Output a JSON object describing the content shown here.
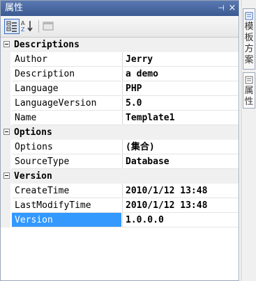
{
  "panel": {
    "title": "属性",
    "pin_glyph": "⊣",
    "close_glyph": "×"
  },
  "toolbar": {
    "icons": [
      "categorized-icon",
      "alphabetical-icon",
      "property-pages-icon"
    ],
    "active": "categorized"
  },
  "categories": [
    {
      "name": "Descriptions",
      "properties": [
        {
          "name": "Author",
          "value": "Jerry"
        },
        {
          "name": "Description",
          "value": "a demo"
        },
        {
          "name": "Language",
          "value": "PHP"
        },
        {
          "name": "LanguageVersion",
          "value": "5.0"
        },
        {
          "name": "Name",
          "value": "Template1"
        }
      ]
    },
    {
      "name": "Options",
      "properties": [
        {
          "name": "Options",
          "value": "(集合)"
        },
        {
          "name": "SourceType",
          "value": "Database"
        }
      ]
    },
    {
      "name": "Version",
      "properties": [
        {
          "name": "CreateTime",
          "value": "2010/1/12 13:48"
        },
        {
          "name": "LastModifyTime",
          "value": "2010/1/12 13:48"
        },
        {
          "name": "Version",
          "value": "1.0.0.0"
        }
      ]
    }
  ],
  "selected_property": "Version",
  "side_tabs": [
    {
      "label": "模板方案"
    },
    {
      "label": "属性"
    }
  ],
  "colors": {
    "title_bar": "#4a6aa5",
    "selection": "#3399ff",
    "category_bg": "#f0f0f0"
  }
}
